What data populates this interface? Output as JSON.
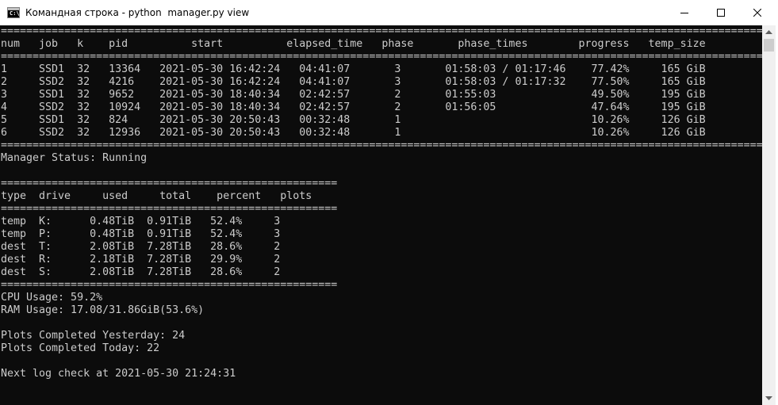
{
  "window": {
    "title": "Командная строка - python  manager.py view",
    "icon": "cmd-icon",
    "controls": [
      "minimize-icon",
      "maximize-icon",
      "close-icon"
    ]
  },
  "console": {
    "lines": [
      "==============================================================================================================================",
      "num   job   k    pid          start          elapsed_time   phase       phase_times        progress   temp_size",
      "==============================================================================================================================",
      "1     SSD1  32   13364   2021-05-30 16:42:24   04:41:07       3       01:58:03 / 01:17:46    77.42%     165 GiB",
      "2     SSD2  32   4216    2021-05-30 16:42:24   04:41:07       3       01:58:03 / 01:17:32    77.50%     165 GiB",
      "3     SSD1  32   9652    2021-05-30 18:40:34   02:42:57       2       01:55:03               49.50%     195 GiB",
      "4     SSD2  32   10924   2021-05-30 18:40:34   02:42:57       2       01:56:05               47.64%     195 GiB",
      "5     SSD1  32   824     2021-05-30 20:50:43   00:32:48       1                              10.26%     126 GiB",
      "6     SSD2  32   12936   2021-05-30 20:50:43   00:32:48       1                              10.26%     126 GiB",
      "==============================================================================================================================",
      "Manager Status: Running",
      "",
      "=====================================================",
      "type  drive     used     total    percent   plots",
      "=====================================================",
      "temp  K:      0.48TiB  0.91TiB   52.4%     3",
      "temp  P:      0.48TiB  0.91TiB   52.4%     3",
      "dest  T:      2.08TiB  7.28TiB   28.6%     2",
      "dest  R:      2.18TiB  7.28TiB   29.9%     2",
      "dest  S:      2.08TiB  7.28TiB   28.6%     2",
      "=====================================================",
      "CPU Usage: 59.2%",
      "RAM Usage: 17.08/31.86GiB(53.6%)",
      "",
      "Plots Completed Yesterday: 24",
      "Plots Completed Today: 22",
      "",
      "Next log check at 2021-05-30 21:24:31"
    ]
  },
  "background_window": {
    "edge_glyphs": [
      "",
      "",
      "",
      "",
      "",
      "",
      "",
      "",
      "",
      "",
      "",
      "",
      "",
      "",
      "",
      "",
      "",
      "",
      "",
      "",
      "",
      "",
      "",
      "",
      "",
      "",
      "",
      ""
    ]
  },
  "colors": {
    "console_bg": "#0c0c0c",
    "console_fg": "#cccccc",
    "titlebar_bg": "#ffffff"
  }
}
